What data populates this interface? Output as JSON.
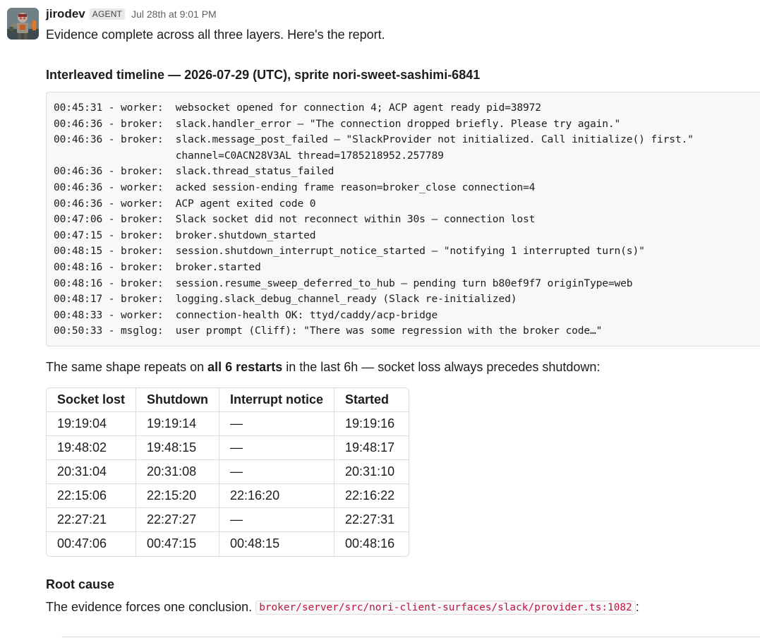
{
  "message": {
    "author": "jirodev",
    "badge": "AGENT",
    "timestamp": "Jul 28th at 9:01 PM",
    "intro": "Evidence complete across all three layers. Here's the report."
  },
  "timeline": {
    "heading": "Interleaved timeline — 2026-07-29 (UTC), sprite nori-sweet-sashimi-6841",
    "lines": [
      "00:45:31 - worker:  websocket opened for connection 4; ACP agent ready pid=38972",
      "00:46:36 - broker:  slack.handler_error — \"The connection dropped briefly. Please try again.\"",
      "00:46:36 - broker:  slack.message_post_failed — \"SlackProvider not initialized. Call initialize() first.\"",
      "                    channel=C0ACN28V3AL thread=1785218952.257789",
      "00:46:36 - broker:  slack.thread_status_failed",
      "00:46:36 - worker:  acked session-ending frame reason=broker_close connection=4",
      "00:46:36 - worker:  ACP agent exited code 0",
      "00:47:06 - broker:  Slack socket did not reconnect within 30s — connection lost",
      "00:47:15 - broker:  broker.shutdown_started",
      "00:48:15 - broker:  session.shutdown_interrupt_notice_started — \"notifying 1 interrupted turn(s)\"",
      "00:48:16 - broker:  broker.started",
      "00:48:16 - broker:  session.resume_sweep_deferred_to_hub — pending turn b80ef9f7 originType=web",
      "00:48:17 - broker:  logging.slack_debug_channel_ready (Slack re-initialized)",
      "00:48:33 - worker:  connection-health OK: ttyd/caddy/acp-bridge",
      "00:50:33 - msglog:  user prompt (Cliff): \"There was some regression with the broker code…\""
    ]
  },
  "summary": {
    "before": "The same shape repeats on ",
    "bold": "all 6 restarts",
    "after": " in the last 6h — socket loss always precedes shutdown:"
  },
  "restarts_table": {
    "headers": [
      "Socket lost",
      "Shutdown",
      "Interrupt notice",
      "Started"
    ],
    "rows": [
      [
        "19:19:04",
        "19:19:14",
        "—",
        "19:19:16"
      ],
      [
        "19:48:02",
        "19:48:15",
        "—",
        "19:48:17"
      ],
      [
        "20:31:04",
        "20:31:08",
        "—",
        "20:31:10"
      ],
      [
        "22:15:06",
        "22:15:20",
        "22:16:20",
        "22:16:22"
      ],
      [
        "22:27:21",
        "22:27:27",
        "—",
        "22:27:31"
      ],
      [
        "00:47:06",
        "00:47:15",
        "00:48:15",
        "00:48:16"
      ]
    ]
  },
  "root_cause": {
    "heading": "Root cause",
    "text": "The evidence forces one conclusion. ",
    "code": "broker/server/src/nori-client-surfaces/slack/provider.ts:1082",
    "suffix": ":"
  },
  "colors": {
    "text": "#1d1c1d",
    "muted": "#616061",
    "inline_code": "#c01343",
    "code_bg": "#f8f8f8",
    "border": "#dddddd"
  },
  "icons": {
    "avatar": "robot-warrior-avatar"
  }
}
